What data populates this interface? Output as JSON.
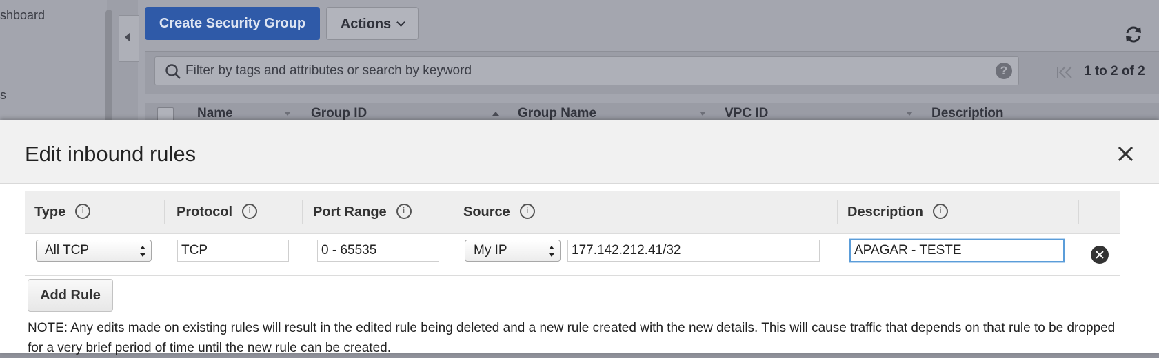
{
  "background": {
    "nav": {
      "dashboard_partial": "shboard",
      "item_partial": "s"
    },
    "toolbar": {
      "create_label": "Create Security Group",
      "actions_label": "Actions"
    },
    "search": {
      "placeholder": "Filter by tags and attributes or search by keyword"
    },
    "pager": {
      "text": "1 to 2 of 2"
    },
    "table": {
      "columns": [
        "Name",
        "Group ID",
        "Group Name",
        "VPC ID",
        "Description"
      ]
    }
  },
  "modal": {
    "title": "Edit inbound rules",
    "headers": {
      "type": "Type",
      "protocol": "Protocol",
      "port_range": "Port Range",
      "source": "Source",
      "description": "Description"
    },
    "rule": {
      "type": "All TCP",
      "protocol": "TCP",
      "port_range": "0 - 65535",
      "source_type": "My IP",
      "source_cidr": "177.142.212.41/32",
      "description": "APAGAR - TESTE"
    },
    "add_rule_label": "Add Rule",
    "note": "NOTE: Any edits made on existing rules will result in the edited rule being deleted and a new rule created with the new details. This will cause traffic that depends on that rule to be dropped for a very brief period of time until the new rule can be created."
  },
  "icons": {
    "info": "i",
    "help": "?"
  },
  "colors": {
    "primary_button": "#2f5aa8",
    "focus_ring": "#5b9dd9"
  }
}
